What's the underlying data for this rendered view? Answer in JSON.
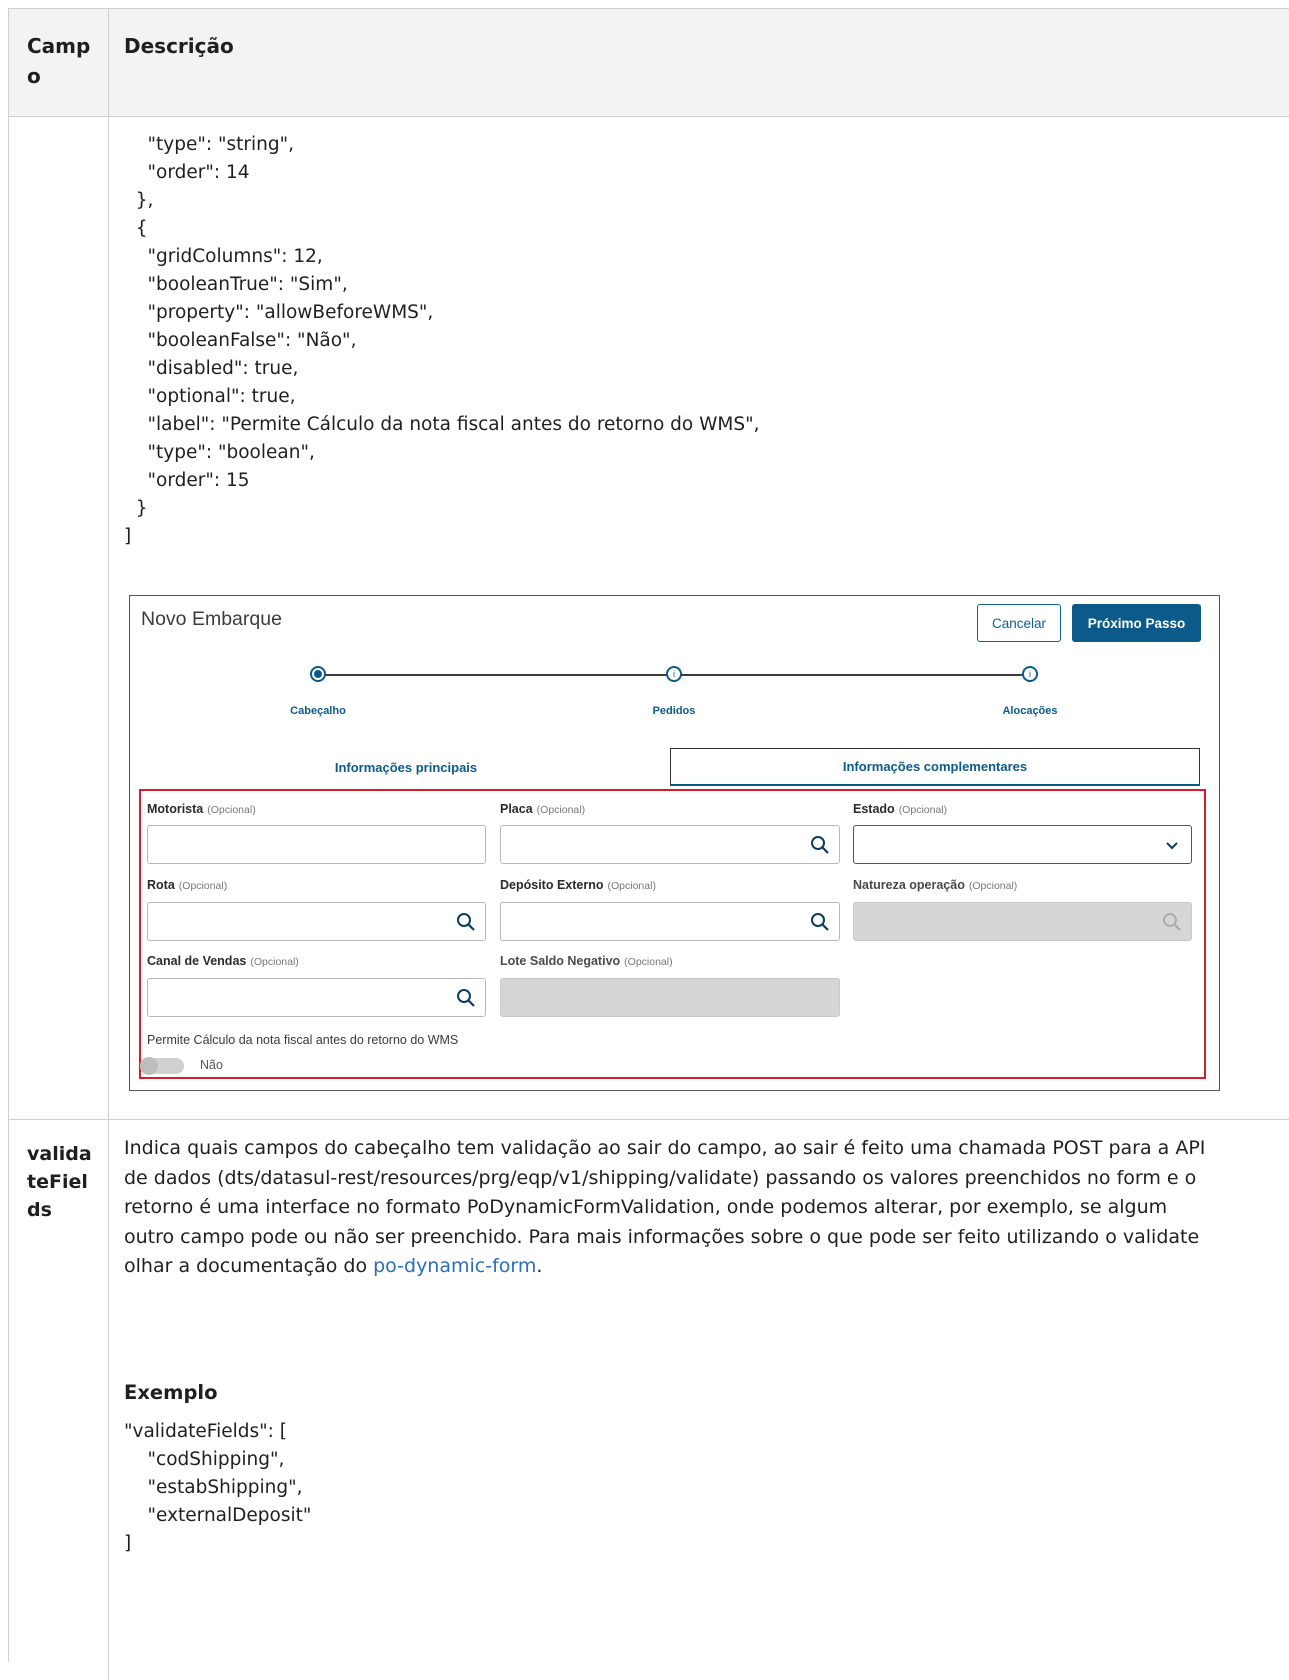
{
  "table": {
    "header": {
      "field": "Campo",
      "description": "Descrição"
    }
  },
  "form_fields_row": {
    "code_lines": [
      "    \"type\": \"string\",",
      "    \"order\": 14",
      "  },",
      "  {",
      "    \"gridColumns\": 12,",
      "    \"booleanTrue\": \"Sim\",",
      "    \"property\": \"allowBeforeWMS\",",
      "    \"booleanFalse\": \"Não\",",
      "    \"disabled\": true,",
      "    \"optional\": true,",
      "    \"label\": \"Permite Cálculo da nota fiscal antes do retorno do WMS\",",
      "    \"type\": \"boolean\",",
      "    \"order\": 15",
      "  }",
      "]"
    ],
    "screenshot": {
      "title": "Novo Embarque",
      "cancel_label": "Cancelar",
      "next_label": "Próximo Passo",
      "steps": [
        {
          "label": "Cabeçalho",
          "state": "active"
        },
        {
          "label": "Pedidos",
          "state": "pending"
        },
        {
          "label": "Alocações",
          "state": "pending"
        }
      ],
      "tabs": [
        {
          "label": "Informações principais",
          "selected": false
        },
        {
          "label": "Informações complementares",
          "selected": true
        }
      ],
      "optional_suffix": "(Opcional)",
      "fields": {
        "motorista": {
          "label": "Motorista",
          "control": "text"
        },
        "placa": {
          "label": "Placa",
          "control": "lookup"
        },
        "estado": {
          "label": "Estado",
          "control": "select"
        },
        "rota": {
          "label": "Rota",
          "control": "lookup"
        },
        "deposito_externo": {
          "label": "Depósito Externo",
          "control": "lookup"
        },
        "natureza_operacao": {
          "label": "Natureza operação",
          "control": "lookup-disabled"
        },
        "canal_vendas": {
          "label": "Canal de Vendas",
          "control": "lookup"
        },
        "lote_saldo_negativo": {
          "label": "Lote Saldo Negativo",
          "control": "text-disabled"
        }
      },
      "boolean_field": {
        "label": "Permite Cálculo da nota fiscal antes do retorno do WMS",
        "value_text": "Não",
        "checked": false
      }
    }
  },
  "validate_row": {
    "field_name": "validateFields",
    "description_before_link": "Indica quais campos do cabeçalho tem validação ao sair do campo, ao sair é feito uma chamada POST para a API de dados (dts/datasul-rest/resources/prg/eqp/v1/shipping/validate) passando os valores preenchidos no form e o retorno é uma interface no formato PoDynamicFormValidation, onde podemos alterar, por exemplo, se algum outro campo pode ou não ser preenchido. Para mais informações sobre o que pode ser feito utilizando o validate olhar a documentação do ",
    "link_text": "po-dynamic-form",
    "description_after_link": ".",
    "example_heading": "Exemplo",
    "code_lines": [
      "\"validateFields\": [",
      "    \"codShipping\",",
      "    \"estabShipping\",",
      "    \"externalDeposit\"",
      "]"
    ]
  },
  "colors": {
    "accent": "#0c5a8a",
    "highlight_border": "#d81e2c",
    "link": "#2a6ebb"
  }
}
